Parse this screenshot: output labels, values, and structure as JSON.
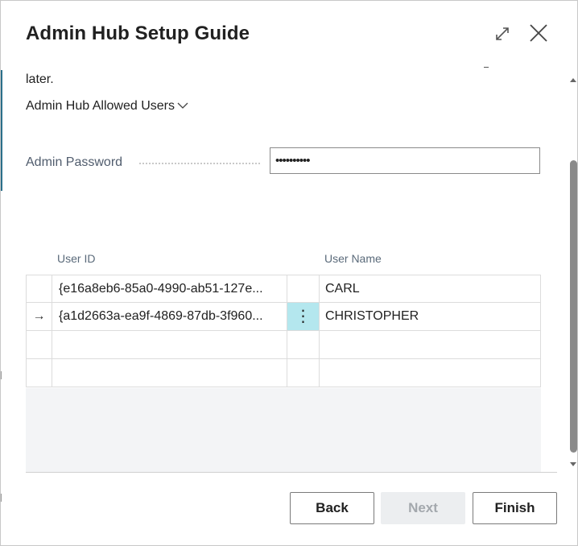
{
  "window": {
    "title": "Admin Hub Setup Guide",
    "expand_icon": "expand-icon",
    "close_icon": "close-icon"
  },
  "content": {
    "intro_text_tail": "later.",
    "section_title": "Admin Hub Allowed Users",
    "password_label": "Admin Password",
    "password_value": "••••••••••"
  },
  "grid": {
    "columns": [
      "User ID",
      "User Name"
    ],
    "rows": [
      {
        "selector": "",
        "user_id": "{e16a8eb6-85a0-4990-ab51-127e...",
        "user_name": "CARL",
        "active": false
      },
      {
        "selector": "→",
        "user_id": "{a1d2663a-ea9f-4869-87db-3f960...",
        "menu": "⋮",
        "user_name": "CHRISTOPHER",
        "active": true
      },
      {
        "selector": "",
        "user_id": "",
        "user_name": "",
        "active": false
      },
      {
        "selector": "",
        "user_id": "",
        "user_name": "",
        "active": false
      }
    ]
  },
  "footer": {
    "back_label": "Back",
    "next_label": "Next",
    "finish_label": "Finish"
  },
  "colors": {
    "active_cell": "#b4e7ee",
    "disabled_button": "#eceef0",
    "label_text": "#505c6d"
  }
}
